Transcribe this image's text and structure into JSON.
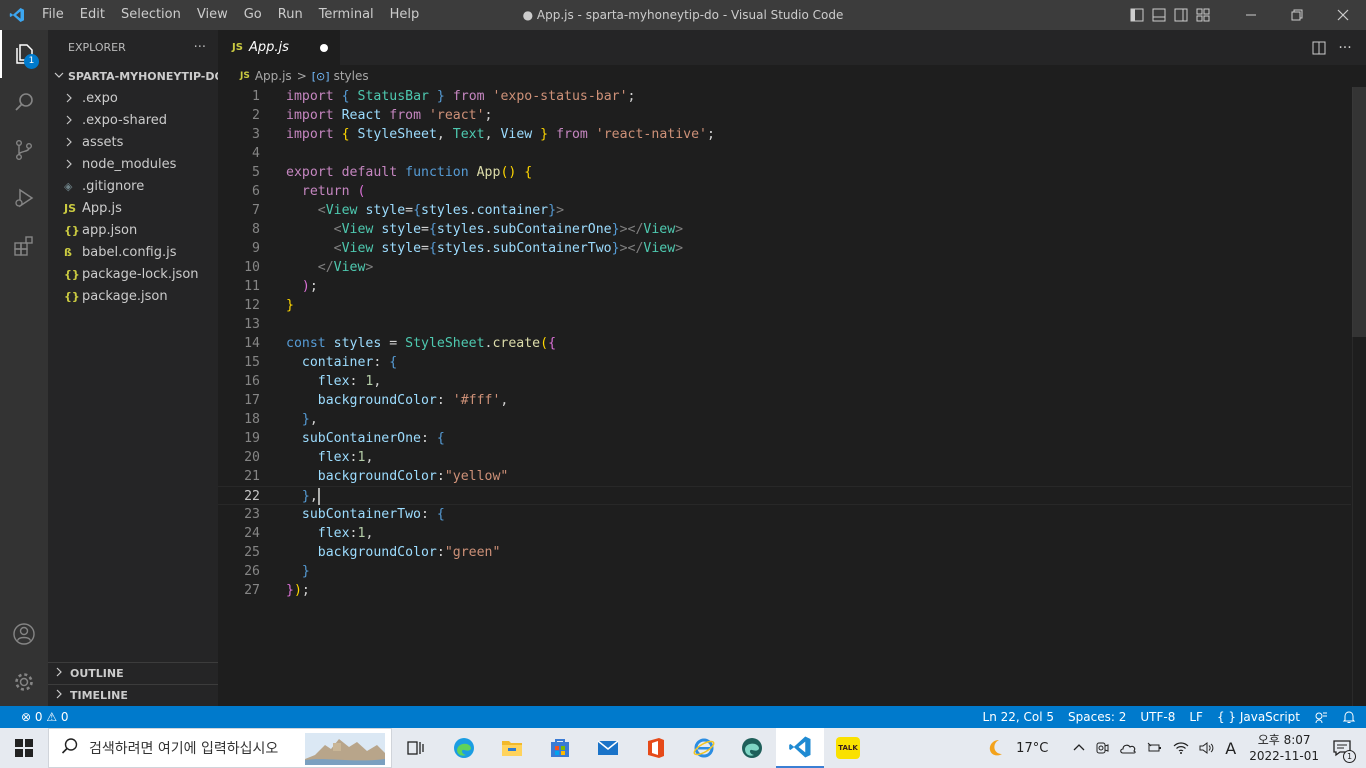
{
  "titlebar": {
    "logo_icon": "vscode-logo-icon",
    "menu": [
      "File",
      "Edit",
      "Selection",
      "View",
      "Go",
      "Run",
      "Terminal",
      "Help"
    ],
    "window_title": "● App.js - sparta-myhoneytip-do - Visual Studio Code",
    "layout_icons": [
      "toggle-primary-sidebar-icon",
      "toggle-panel-icon",
      "toggle-secondary-sidebar-icon",
      "customize-layout-icon"
    ],
    "window_controls": [
      "minimize-icon",
      "restore-icon",
      "close-icon"
    ]
  },
  "activity_bar": {
    "items": [
      {
        "name": "explorer-icon",
        "badge": "1",
        "active": true
      },
      {
        "name": "search-icon"
      },
      {
        "name": "source-control-icon"
      },
      {
        "name": "run-debug-icon"
      },
      {
        "name": "extensions-icon"
      }
    ],
    "bottom": [
      "accounts-icon",
      "manage-gear-icon"
    ]
  },
  "sidebar": {
    "title": "EXPLORER",
    "more": "···",
    "project": "SPARTA-MYHONEYTIP-DO",
    "tree": [
      {
        "type": "folder",
        "label": ".expo"
      },
      {
        "type": "folder",
        "label": ".expo-shared"
      },
      {
        "type": "folder",
        "label": "assets"
      },
      {
        "type": "folder",
        "label": "node_modules"
      },
      {
        "type": "file",
        "icon": "◈",
        "icon_color": "#6d8086",
        "label": ".gitignore"
      },
      {
        "type": "file",
        "icon": "JS",
        "icon_color": "#cbcb41",
        "label": "App.js"
      },
      {
        "type": "file",
        "icon": "{}",
        "icon_color": "#cbcb41",
        "label": "app.json"
      },
      {
        "type": "file",
        "icon": "ß",
        "icon_color": "#cbcb41",
        "label": "babel.config.js"
      },
      {
        "type": "file",
        "icon": "{}",
        "icon_color": "#cbcb41",
        "label": "package-lock.json"
      },
      {
        "type": "file",
        "icon": "{}",
        "icon_color": "#cbcb41",
        "label": "package.json"
      }
    ],
    "outline": "OUTLINE",
    "timeline": "TIMELINE"
  },
  "editor": {
    "tab": {
      "icon": "JS",
      "label": "App.js"
    },
    "breadcrumb": {
      "icon": "JS",
      "file": "App.js",
      "separator": ">",
      "symbol_icon": "[⊙]",
      "symbol": "styles"
    },
    "current_line": 22,
    "lines": [
      [
        [
          "k",
          "import"
        ],
        [
          "d",
          " "
        ],
        [
          "b",
          "{"
        ],
        [
          "d",
          " "
        ],
        [
          "c",
          "StatusBar"
        ],
        [
          "d",
          " "
        ],
        [
          "b",
          "}"
        ],
        [
          "d",
          " "
        ],
        [
          "k",
          "from"
        ],
        [
          "d",
          " "
        ],
        [
          "s",
          "'expo-status-bar'"
        ],
        [
          "d",
          ";"
        ]
      ],
      [
        [
          "k",
          "import"
        ],
        [
          "d",
          " "
        ],
        [
          "v",
          "React"
        ],
        [
          "d",
          " "
        ],
        [
          "k",
          "from"
        ],
        [
          "d",
          " "
        ],
        [
          "s",
          "'react'"
        ],
        [
          "d",
          ";"
        ]
      ],
      [
        [
          "k",
          "import"
        ],
        [
          "d",
          " "
        ],
        [
          "y",
          "{"
        ],
        [
          "d",
          " "
        ],
        [
          "v",
          "StyleSheet"
        ],
        [
          "d",
          ", "
        ],
        [
          "c",
          "Text"
        ],
        [
          "d",
          ", "
        ],
        [
          "v",
          "View"
        ],
        [
          "d",
          " "
        ],
        [
          "y",
          "}"
        ],
        [
          "d",
          " "
        ],
        [
          "k",
          "from"
        ],
        [
          "d",
          " "
        ],
        [
          "s",
          "'react-native'"
        ],
        [
          "d",
          ";"
        ]
      ],
      [],
      [
        [
          "k",
          "export"
        ],
        [
          "d",
          " "
        ],
        [
          "k",
          "default"
        ],
        [
          "d",
          " "
        ],
        [
          "b",
          "function"
        ],
        [
          "d",
          " "
        ],
        [
          "f",
          "App"
        ],
        [
          "y",
          "()"
        ],
        [
          "d",
          " "
        ],
        [
          "y",
          "{"
        ]
      ],
      [
        [
          "d",
          "  "
        ],
        [
          "k",
          "return"
        ],
        [
          "d",
          " "
        ],
        [
          "p",
          "("
        ]
      ],
      [
        [
          "d",
          "    "
        ],
        [
          "t",
          "<"
        ],
        [
          "c",
          "View"
        ],
        [
          "d",
          " "
        ],
        [
          "v",
          "style"
        ],
        [
          "d",
          "="
        ],
        [
          "b",
          "{"
        ],
        [
          "v",
          "styles"
        ],
        [
          "d",
          "."
        ],
        [
          "v",
          "container"
        ],
        [
          "b",
          "}"
        ],
        [
          "t",
          ">"
        ]
      ],
      [
        [
          "d",
          "      "
        ],
        [
          "t",
          "<"
        ],
        [
          "c",
          "View"
        ],
        [
          "d",
          " "
        ],
        [
          "v",
          "style"
        ],
        [
          "d",
          "="
        ],
        [
          "b",
          "{"
        ],
        [
          "v",
          "styles"
        ],
        [
          "d",
          "."
        ],
        [
          "v",
          "subContainerOne"
        ],
        [
          "b",
          "}"
        ],
        [
          "t",
          "></"
        ],
        [
          "c",
          "View"
        ],
        [
          "t",
          ">"
        ]
      ],
      [
        [
          "d",
          "      "
        ],
        [
          "t",
          "<"
        ],
        [
          "c",
          "View"
        ],
        [
          "d",
          " "
        ],
        [
          "v",
          "style"
        ],
        [
          "d",
          "="
        ],
        [
          "b",
          "{"
        ],
        [
          "v",
          "styles"
        ],
        [
          "d",
          "."
        ],
        [
          "v",
          "subContainerTwo"
        ],
        [
          "b",
          "}"
        ],
        [
          "t",
          "></"
        ],
        [
          "c",
          "View"
        ],
        [
          "t",
          ">"
        ]
      ],
      [
        [
          "d",
          "    "
        ],
        [
          "t",
          "</"
        ],
        [
          "c",
          "View"
        ],
        [
          "t",
          ">"
        ]
      ],
      [
        [
          "d",
          "  "
        ],
        [
          "p",
          ")"
        ],
        [
          "d",
          ";"
        ]
      ],
      [
        [
          "y",
          "}"
        ]
      ],
      [],
      [
        [
          "b",
          "const"
        ],
        [
          "d",
          " "
        ],
        [
          "v",
          "styles"
        ],
        [
          "d",
          " = "
        ],
        [
          "c",
          "StyleSheet"
        ],
        [
          "d",
          "."
        ],
        [
          "f",
          "create"
        ],
        [
          "y",
          "("
        ],
        [
          "p",
          "{"
        ]
      ],
      [
        [
          "d",
          "  "
        ],
        [
          "v",
          "container"
        ],
        [
          "d",
          ": "
        ],
        [
          "b",
          "{"
        ]
      ],
      [
        [
          "d",
          "    "
        ],
        [
          "v",
          "flex"
        ],
        [
          "d",
          ": "
        ],
        [
          "n",
          "1"
        ],
        [
          "d",
          ","
        ]
      ],
      [
        [
          "d",
          "    "
        ],
        [
          "v",
          "backgroundColor"
        ],
        [
          "d",
          ": "
        ],
        [
          "s",
          "'#fff'"
        ],
        [
          "d",
          ","
        ]
      ],
      [
        [
          "d",
          "  "
        ],
        [
          "b",
          "}"
        ],
        [
          "d",
          ","
        ]
      ],
      [
        [
          "d",
          "  "
        ],
        [
          "v",
          "subContainerOne"
        ],
        [
          "d",
          ": "
        ],
        [
          "b",
          "{"
        ]
      ],
      [
        [
          "d",
          "    "
        ],
        [
          "v",
          "flex"
        ],
        [
          "d",
          ":"
        ],
        [
          "n",
          "1"
        ],
        [
          "d",
          ","
        ]
      ],
      [
        [
          "d",
          "    "
        ],
        [
          "v",
          "backgroundColor"
        ],
        [
          "d",
          ":"
        ],
        [
          "s",
          "\"yellow\""
        ]
      ],
      [
        [
          "d",
          "  "
        ],
        [
          "b",
          "}"
        ],
        [
          "d",
          ","
        ],
        [
          "cursor",
          ""
        ]
      ],
      [
        [
          "d",
          "  "
        ],
        [
          "v",
          "subContainerTwo"
        ],
        [
          "d",
          ": "
        ],
        [
          "b",
          "{"
        ]
      ],
      [
        [
          "d",
          "    "
        ],
        [
          "v",
          "flex"
        ],
        [
          "d",
          ":"
        ],
        [
          "n",
          "1"
        ],
        [
          "d",
          ","
        ]
      ],
      [
        [
          "d",
          "    "
        ],
        [
          "v",
          "backgroundColor"
        ],
        [
          "d",
          ":"
        ],
        [
          "s",
          "\"green\""
        ]
      ],
      [
        [
          "d",
          "  "
        ],
        [
          "b",
          "}"
        ]
      ],
      [
        [
          "p",
          "}"
        ],
        [
          "y",
          ")"
        ],
        [
          "d",
          ";"
        ]
      ]
    ]
  },
  "statusbar": {
    "problems": "⊗ 0 ⚠ 0",
    "position": "Ln 22, Col 5",
    "spaces": "Spaces: 2",
    "encoding": "UTF-8",
    "eol": "LF",
    "language": "{ } JavaScript",
    "feedback_icon": "feedback-icon",
    "notifications_icon": "bell-icon"
  },
  "taskbar": {
    "search_placeholder": "검색하려면 여기에 입력하십시오",
    "apps": [
      "task-view-icon",
      "edge-icon",
      "file-explorer-icon",
      "store-icon",
      "mail-icon",
      "office-icon",
      "ie-icon",
      "edge-dev-icon",
      "vscode-icon",
      "kakaotalk-icon"
    ],
    "active_app": "vscode-icon",
    "kakao_label": "TALK",
    "weather": "17°C",
    "ime": "A",
    "time": "오후 8:07",
    "date": "2022-11-01",
    "notification_count": "1"
  }
}
